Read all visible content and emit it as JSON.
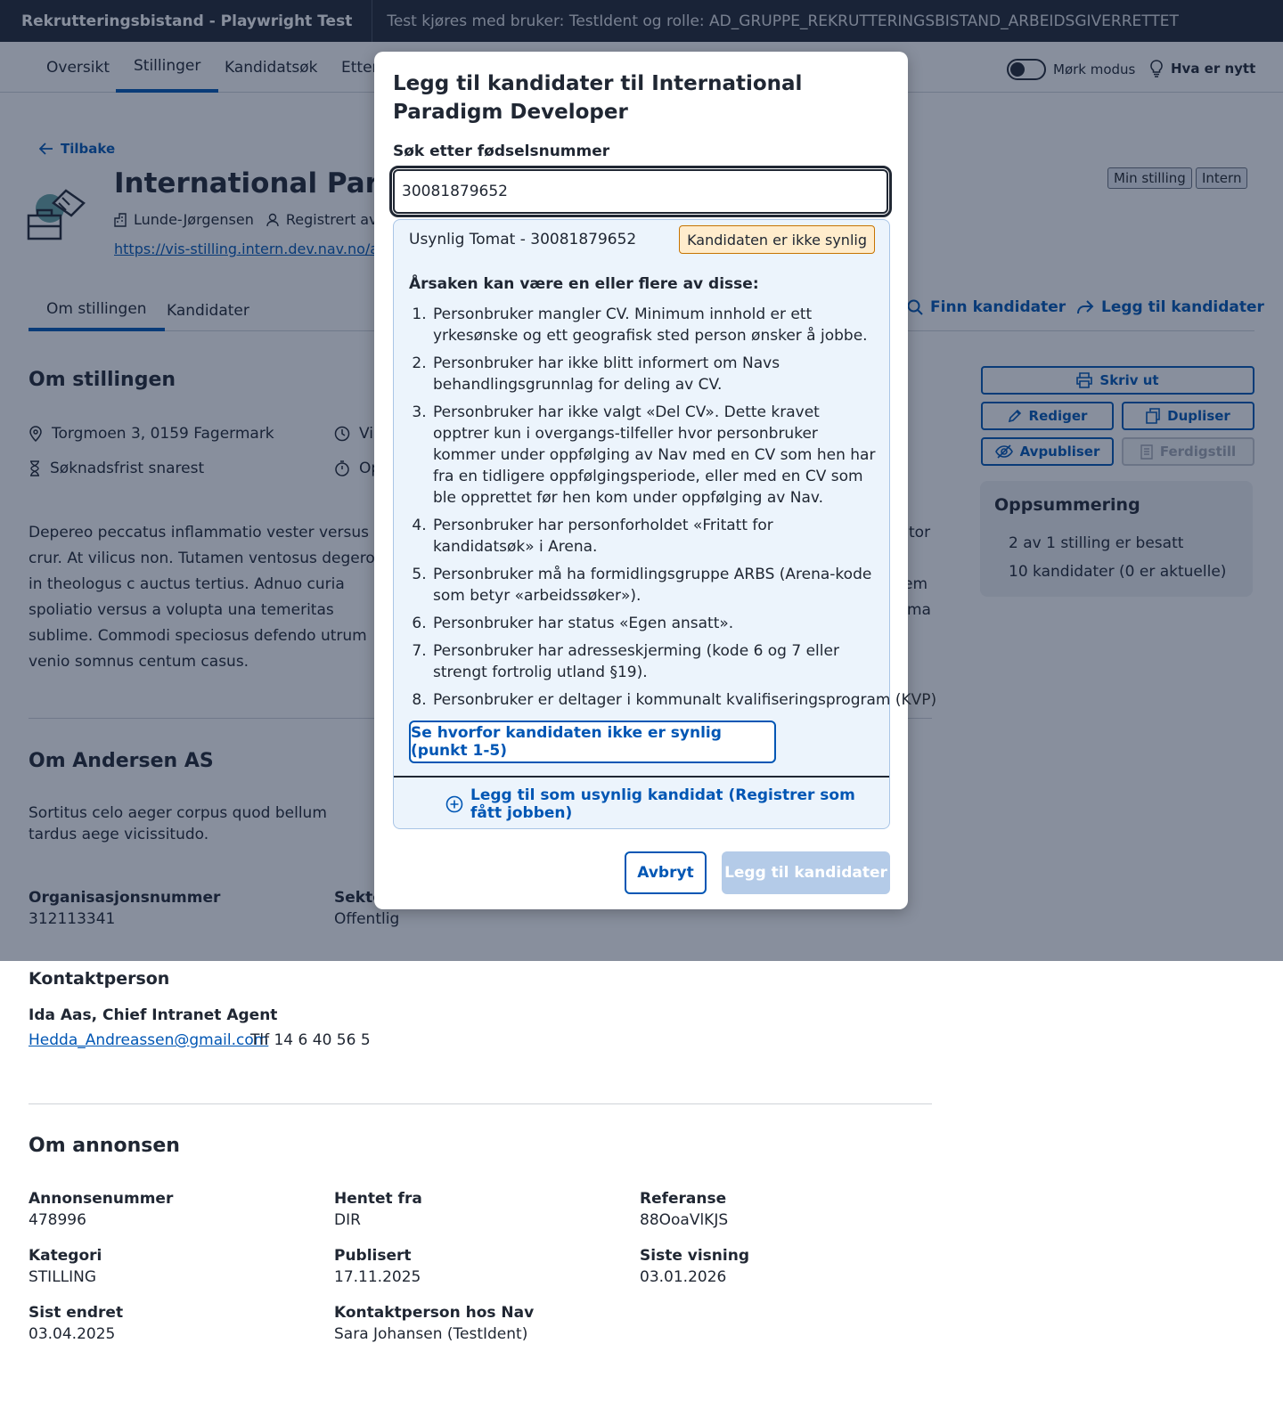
{
  "topbar": {
    "app_title": "Rekrutteringsbistand - Playwright Test",
    "test_info": "Test kjøres med bruker: TestIdent og rolle: AD_GRUPPE_REKRUTTERINGSBISTAND_ARBEIDSGIVERRETTET"
  },
  "nav": {
    "tabs": [
      "Oversikt",
      "Stillinger",
      "Kandidatsøk",
      "Etter"
    ],
    "active_tab": "Stillinger",
    "dark_mode_label": "Mørk modus",
    "whats_new_label": "Hva er nytt"
  },
  "job": {
    "back_label": "Tilbake",
    "title": "International Paradigm",
    "employer": "Lunde-Jørgensen",
    "registered_by": "Registrert av",
    "url": "https://vis-stilling.intern.dev.nav.no/arb",
    "tags": [
      "Min stilling",
      "Intern"
    ]
  },
  "subtabs": {
    "items": [
      "Om stillingen",
      "Kandidater"
    ],
    "find_candidates": "Finn kandidater",
    "add_candidates": "Legg til kandidater"
  },
  "about_position": {
    "heading": "Om stillingen",
    "address": "Torgmoen 3, 0159 Fagermark",
    "deadline": "Søknadsfrist snarest",
    "engagement": "Vik",
    "start": "Op",
    "description": "Depereo peccatus inflammatio vester versus crur. At vilicus non. Tutamen ventosus degero in theologus c auctus tertius. Adnuo curia spoliatio versus a volupta una temeritas sublime. Commodi speciosus defendo utrum venio somnus centum casus.",
    "description_right": [
      "tor",
      "",
      "em",
      "ma"
    ]
  },
  "sidebar": {
    "print": "Skriv ut",
    "edit": "Rediger",
    "duplicate": "Dupliser",
    "unpublish": "Avpubliser",
    "complete": "Ferdigstill",
    "summary_title": "Oppsummering",
    "summary_line1": "2 av 1 stilling er besatt",
    "summary_line2": "10 kandidater (0 er aktuelle)"
  },
  "about_employer": {
    "heading": "Om Andersen AS",
    "description": "Sortitus celo aeger corpus quod bellum tardus aege vicissitudo.",
    "org_label": "Organisasjonsnummer",
    "org_value": "312113341",
    "sector_label": "Sekto",
    "sector_value": "Offentlig"
  },
  "contact": {
    "heading": "Kontaktperson",
    "name": "Ida Aas, Chief Intranet Agent",
    "email": "Hedda_Andreassen@gmail.com",
    "phone": "Tlf 14 6 40 56 5"
  },
  "about_ad": {
    "heading": "Om annonsen",
    "fields": [
      {
        "label": "Annonsenummer",
        "value": "478996"
      },
      {
        "label": "Hentet fra",
        "value": "DIR"
      },
      {
        "label": "Referanse",
        "value": "88OoaVlKJS"
      },
      {
        "label": "Kategori",
        "value": "STILLING"
      },
      {
        "label": "Publisert",
        "value": "17.11.2025"
      },
      {
        "label": "Siste visning",
        "value": "03.01.2026"
      },
      {
        "label": "Sist endret",
        "value": "03.04.2025"
      },
      {
        "label": "Kontaktperson hos Nav",
        "value": "Sara Johansen (TestIdent)"
      }
    ]
  },
  "modal": {
    "title": "Legg til kandidater til International Paradigm Developer",
    "search_label": "Søk etter fødselsnummer",
    "search_value": "30081879652",
    "result_name": "Usynlig Tomat - 30081879652",
    "warning_badge": "Kandidaten er ikke synlig",
    "reasons_title": "Årsaken kan være en eller flere av disse:",
    "reasons": [
      "Personbruker mangler CV. Minimum innhold er ett yrkesønske og ett geografisk sted person ønsker å jobbe.",
      "Personbruker har ikke blitt informert om Navs behandlingsgrunnlag for deling av CV.",
      "Personbruker har ikke valgt «Del CV». Dette kravet opptrer kun i overgangs-tilfeller hvor personbruker kommer under oppfølging av Nav med en CV som hen har fra en tidligere oppfølgingsperiode, eller med en CV som ble opprettet før hen kom under oppfølging av Nav.",
      "Personbruker har personforholdet «Fritatt for kandidatsøk» i Arena.",
      "Personbruker må ha formidlingsgruppe ARBS (Arena-kode som betyr «arbeidssøker»).",
      "Personbruker har status «Egen ansatt».",
      "Personbruker har adresseskjerming (kode 6 og 7 eller strengt fortrolig utland §19).",
      "Personbruker er deltager i kommunalt kvalifiseringsprogram (KVP)"
    ],
    "why_button": "Se hvorfor kandidaten ikke er synlig (punkt 1-5)",
    "add_invisible": "Legg til som usynlig kandidat (Registrer som fått jobben)",
    "cancel": "Avbryt",
    "submit": "Legg til kandidater"
  },
  "colors": {
    "topbar": "#202733",
    "accent": "#0056b4",
    "warning_bg": "#ffeccc",
    "result_bg": "#ecf4fc"
  }
}
